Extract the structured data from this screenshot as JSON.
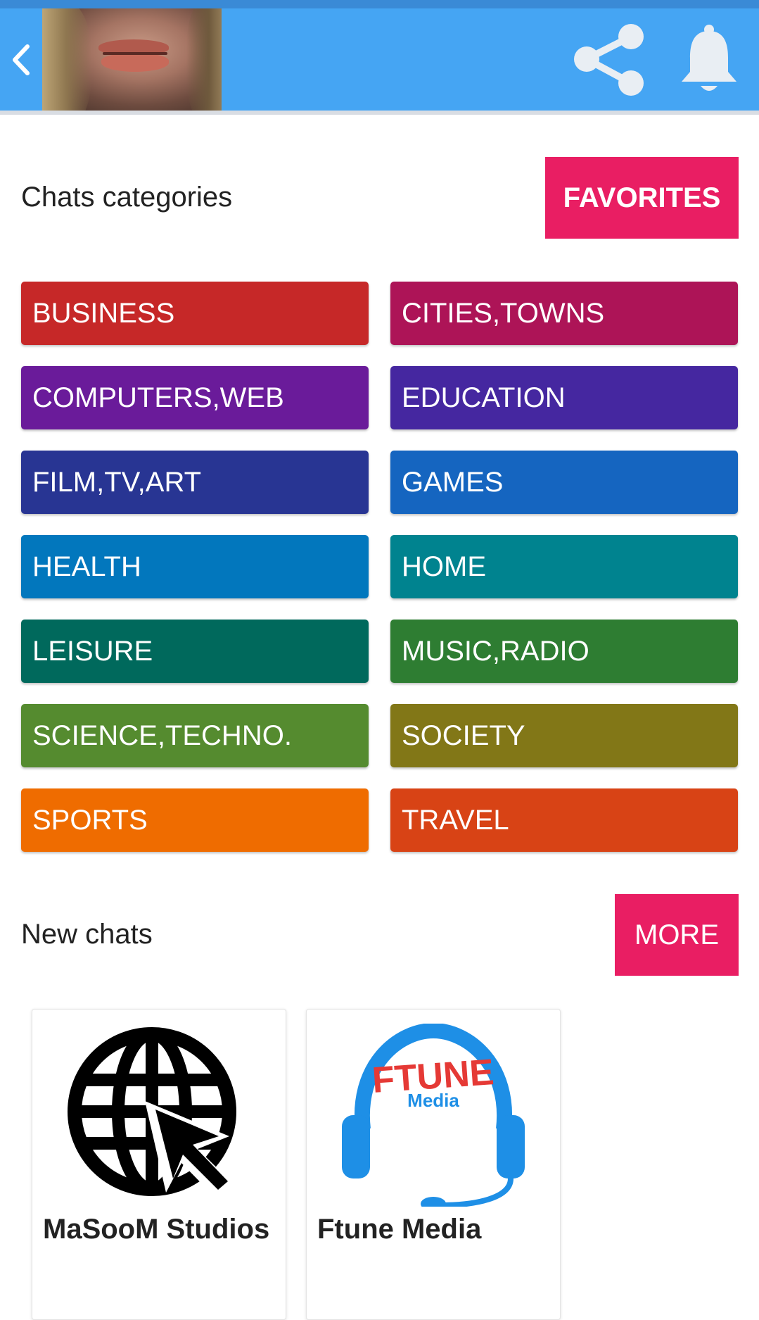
{
  "header": {
    "back_icon": "chevron-left-icon",
    "share_icon": "share-icon",
    "bell_icon": "bell-icon"
  },
  "categories_section": {
    "title": "Chats categories",
    "favorites_label": "FAVORITES"
  },
  "categories": [
    {
      "label": "BUSINESS",
      "color": "#c62828"
    },
    {
      "label": "CITIES,TOWNS",
      "color": "#ad1457"
    },
    {
      "label": "COMPUTERS,WEB",
      "color": "#6a1b9a"
    },
    {
      "label": "EDUCATION",
      "color": "#4527a0"
    },
    {
      "label": "FILM,TV,ART",
      "color": "#283593"
    },
    {
      "label": "GAMES",
      "color": "#1565c0"
    },
    {
      "label": "HEALTH",
      "color": "#0277bd"
    },
    {
      "label": "HOME",
      "color": "#00838f"
    },
    {
      "label": "LEISURE",
      "color": "#00695c"
    },
    {
      "label": "MUSIC,RADIO",
      "color": "#2e7d32"
    },
    {
      "label": "SCIENCE,TECHNO.",
      "color": "#558b2f"
    },
    {
      "label": "SOCIETY",
      "color": "#827717"
    },
    {
      "label": "SPORTS",
      "color": "#ef6c00"
    },
    {
      "label": "TRAVEL",
      "color": "#d84315"
    }
  ],
  "new_chats": {
    "title": "New chats",
    "more_label": "MORE",
    "items": [
      {
        "name": "MaSooM Studios",
        "logo": "globe-cursor-icon"
      },
      {
        "name": "Ftune Media",
        "logo": "headset-logo-icon",
        "logo_top": "FTUNE",
        "logo_sub": "Media"
      }
    ]
  },
  "colors": {
    "appbar": "#45a5f3",
    "accent": "#e91e63"
  }
}
